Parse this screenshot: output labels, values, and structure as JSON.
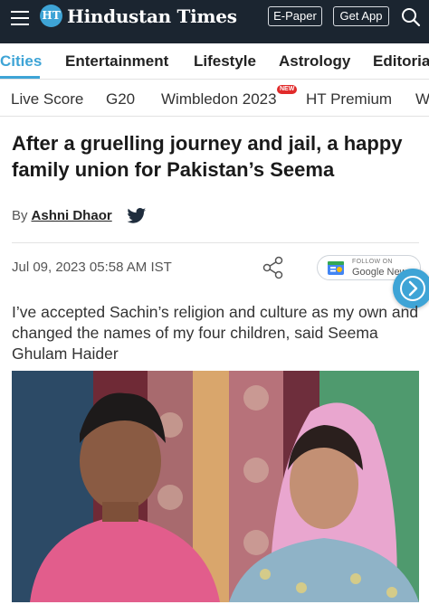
{
  "header": {
    "logo_badge": "HT",
    "logo_text": "Hindustan Times",
    "epaper_label": "E-Paper",
    "getapp_label": "Get App",
    "icons": [
      "menu-icon",
      "search-icon"
    ],
    "colors": {
      "background": "#1b2530",
      "accent": "#3ea4d6"
    }
  },
  "sections_nav": {
    "items": [
      "Cities",
      "Entertainment",
      "Lifestyle",
      "Astrology",
      "Editorial"
    ],
    "active": "Cities"
  },
  "trending_nav": {
    "items": [
      "Live Score",
      "G20",
      "Wimbledon 2023",
      "HT Premium",
      "W"
    ],
    "new_badge": "NEW"
  },
  "article": {
    "headline": "After a gruelling journey and jail, a happy family union for Pakistan’s Seema",
    "byline_prefix": "By",
    "author": "Ashni Dhaor",
    "dateline": "Jul 09, 2023 05:58 AM IST",
    "summary": "I’ve accepted Sachin’s religion and culture as my own and changed the names of my four children, said Seema Ghulam Haider",
    "icons": [
      "twitter-icon",
      "share-icon",
      "google-news-icon",
      "next-arrow-icon"
    ]
  },
  "google_news": {
    "follow_label": "FOLLOW ON",
    "name": "Google News"
  }
}
